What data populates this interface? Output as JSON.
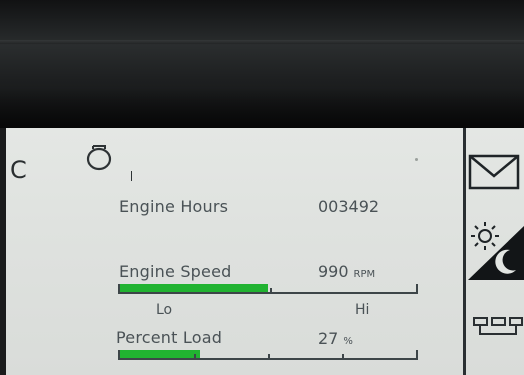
{
  "side_letter": "C",
  "readouts": {
    "engine_hours": {
      "label": "Engine Hours",
      "value": "003492"
    },
    "engine_speed": {
      "label": "Engine Speed",
      "value": "990",
      "unit": "RPM",
      "level": 0.5,
      "scale_lo": "Lo",
      "scale_hi": "Hi"
    },
    "percent_load": {
      "label": "Percent Load",
      "value": "27",
      "unit": "%",
      "level": 0.27
    }
  },
  "icons": [
    "engine-icon",
    "envelope-icon",
    "day-night-icon",
    "menu-icon"
  ],
  "colors": {
    "screen": "#e2e5e2",
    "bar_fill": "#21b331",
    "text": "#4a5256"
  }
}
